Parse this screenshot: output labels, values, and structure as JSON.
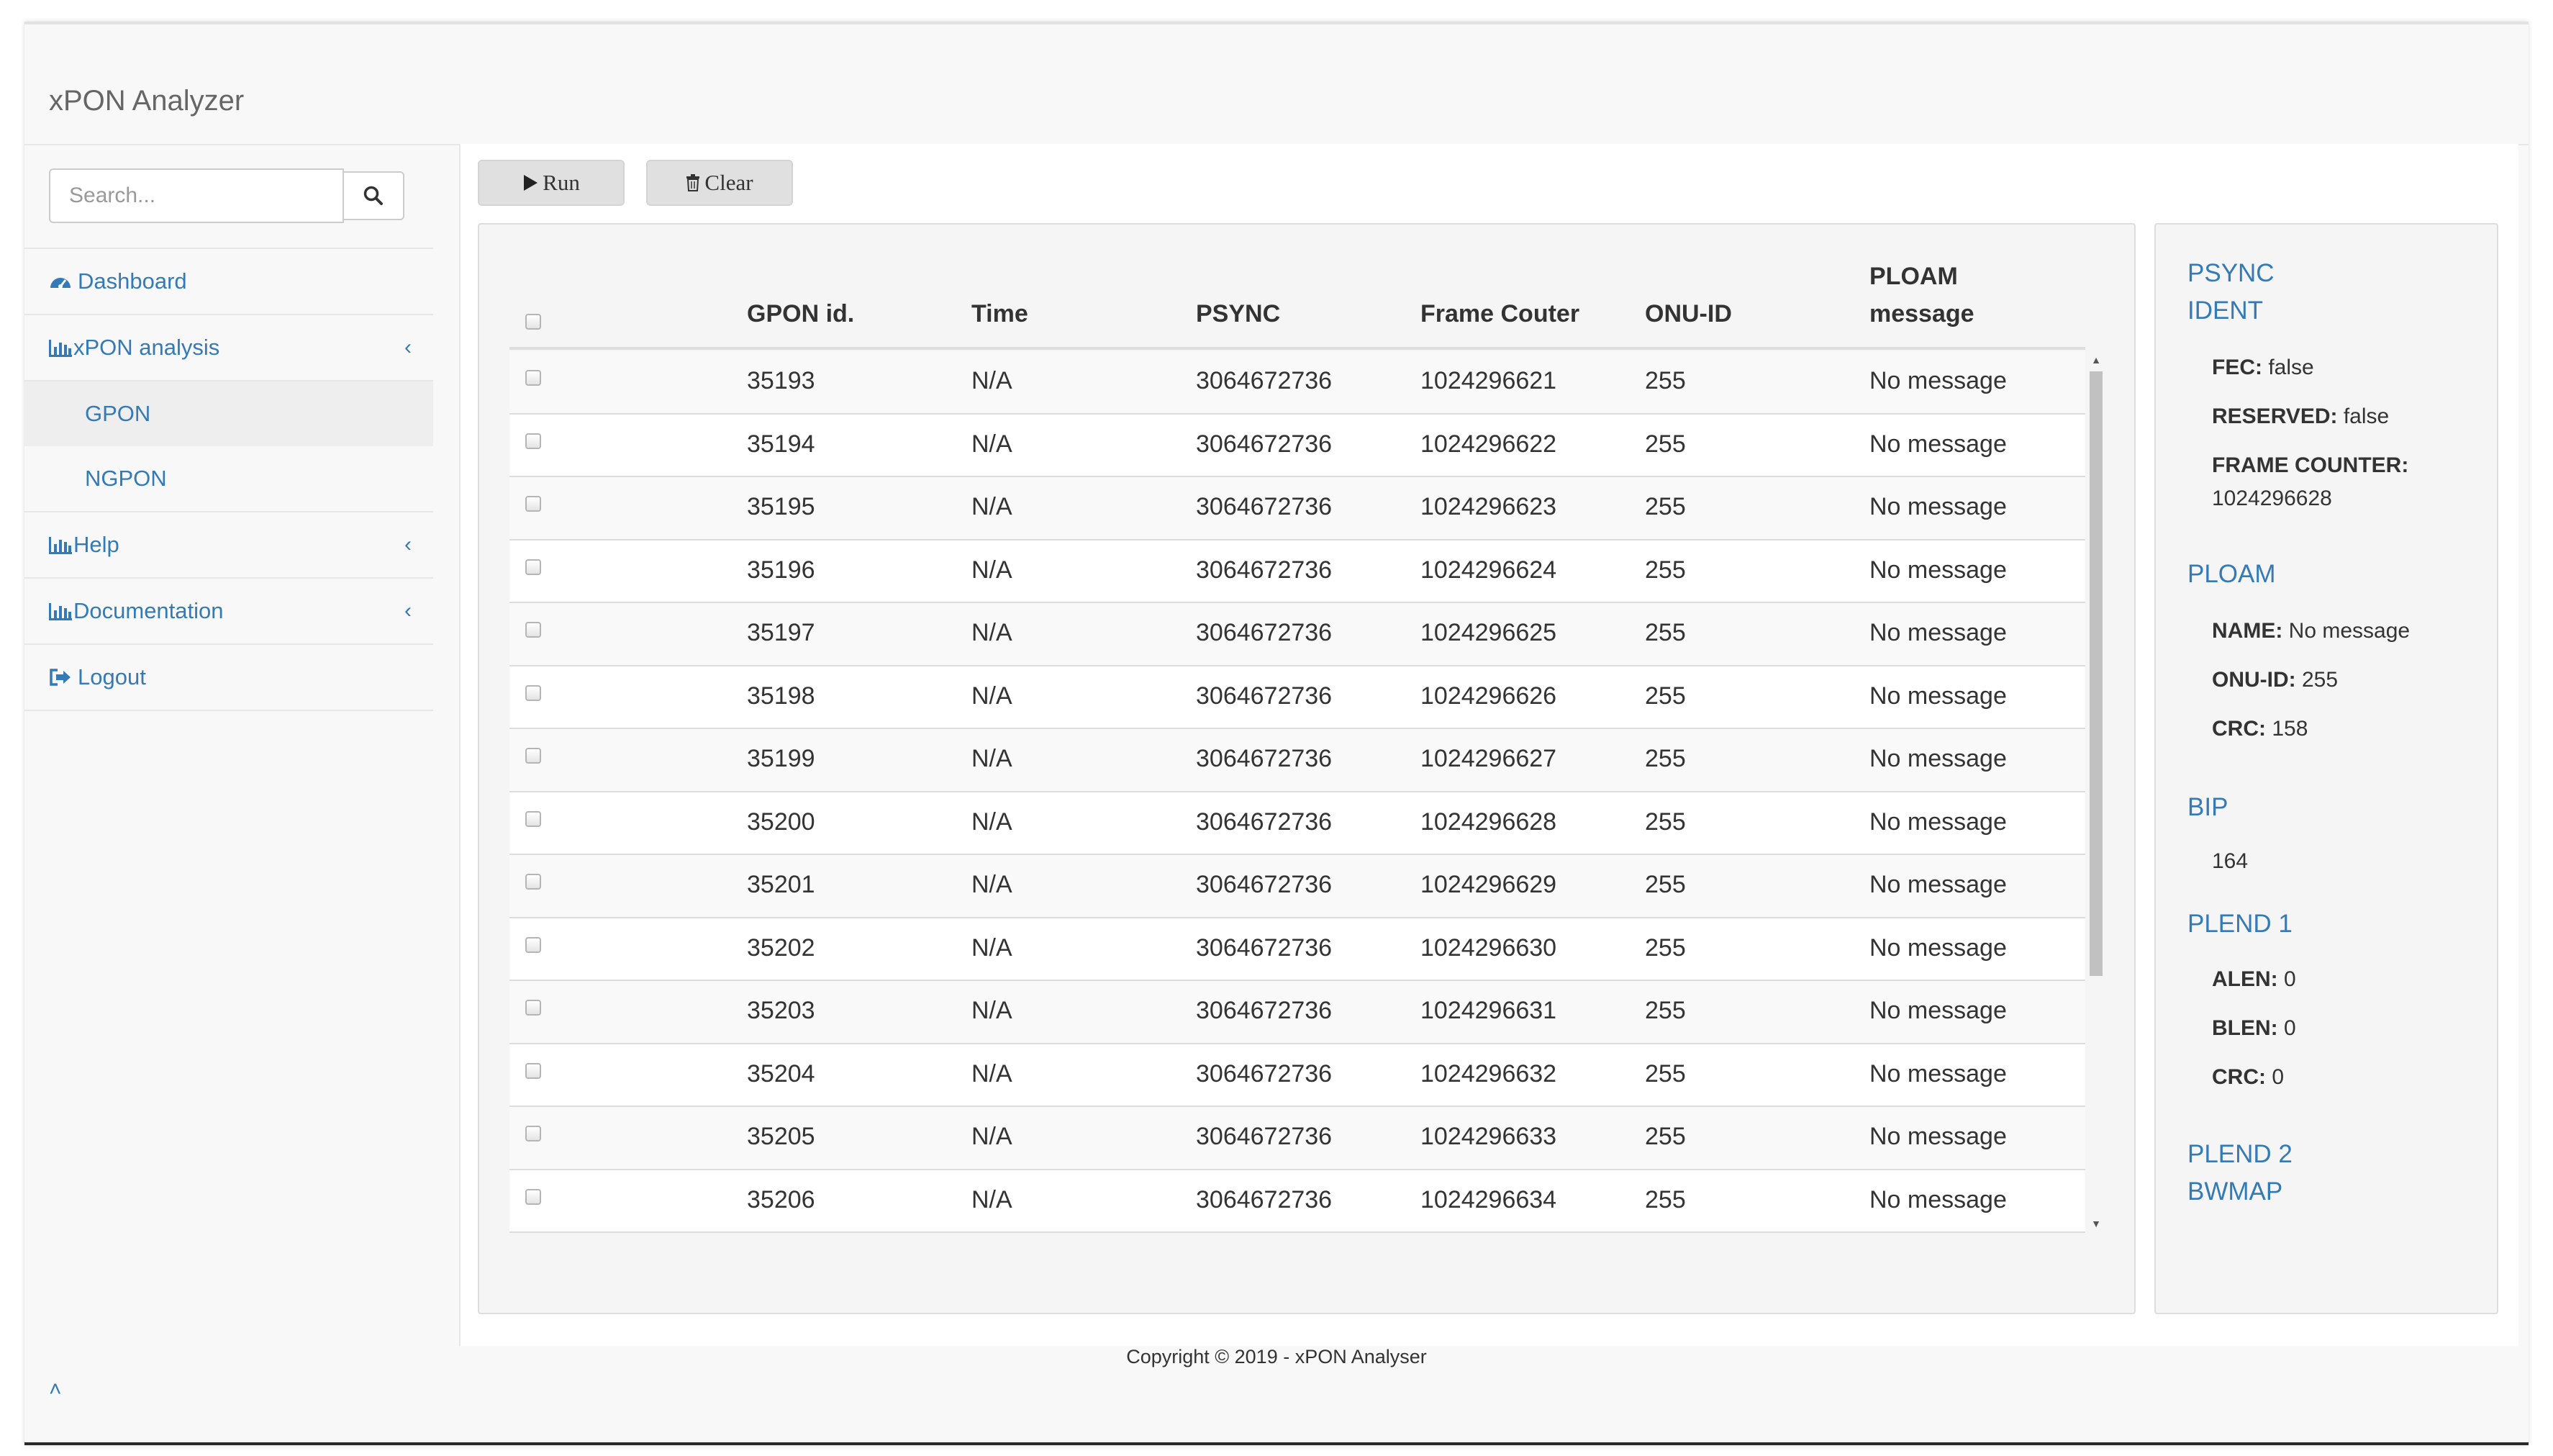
{
  "app": {
    "title": "xPON Analyzer"
  },
  "search": {
    "placeholder": "Search..."
  },
  "sidebar": {
    "dashboard": "Dashboard",
    "xpon_analysis": "xPON analysis",
    "submenu": [
      "GPON",
      "NGPON"
    ],
    "help": "Help",
    "documentation": "Documentation",
    "logout": "Logout"
  },
  "toolbar": {
    "run_label": "Run",
    "clear_label": "Clear"
  },
  "table": {
    "headers": {
      "gpon_id": "GPON id.",
      "time": "Time",
      "psync": "PSYNC",
      "frame_counter": "Frame Couter",
      "onu_id": "ONU-ID",
      "ploam_1": "PLOAM",
      "ploam_2": "message"
    },
    "rows": [
      {
        "id": "35193",
        "time": "N/A",
        "psync": "3064672736",
        "frame": "1024296621",
        "onu": "255",
        "msg": "No message"
      },
      {
        "id": "35194",
        "time": "N/A",
        "psync": "3064672736",
        "frame": "1024296622",
        "onu": "255",
        "msg": "No message"
      },
      {
        "id": "35195",
        "time": "N/A",
        "psync": "3064672736",
        "frame": "1024296623",
        "onu": "255",
        "msg": "No message"
      },
      {
        "id": "35196",
        "time": "N/A",
        "psync": "3064672736",
        "frame": "1024296624",
        "onu": "255",
        "msg": "No message"
      },
      {
        "id": "35197",
        "time": "N/A",
        "psync": "3064672736",
        "frame": "1024296625",
        "onu": "255",
        "msg": "No message"
      },
      {
        "id": "35198",
        "time": "N/A",
        "psync": "3064672736",
        "frame": "1024296626",
        "onu": "255",
        "msg": "No message"
      },
      {
        "id": "35199",
        "time": "N/A",
        "psync": "3064672736",
        "frame": "1024296627",
        "onu": "255",
        "msg": "No message"
      },
      {
        "id": "35200",
        "time": "N/A",
        "psync": "3064672736",
        "frame": "1024296628",
        "onu": "255",
        "msg": "No message"
      },
      {
        "id": "35201",
        "time": "N/A",
        "psync": "3064672736",
        "frame": "1024296629",
        "onu": "255",
        "msg": "No message"
      },
      {
        "id": "35202",
        "time": "N/A",
        "psync": "3064672736",
        "frame": "1024296630",
        "onu": "255",
        "msg": "No message"
      },
      {
        "id": "35203",
        "time": "N/A",
        "psync": "3064672736",
        "frame": "1024296631",
        "onu": "255",
        "msg": "No message"
      },
      {
        "id": "35204",
        "time": "N/A",
        "psync": "3064672736",
        "frame": "1024296632",
        "onu": "255",
        "msg": "No message"
      },
      {
        "id": "35205",
        "time": "N/A",
        "psync": "3064672736",
        "frame": "1024296633",
        "onu": "255",
        "msg": "No message"
      },
      {
        "id": "35206",
        "time": "N/A",
        "psync": "3064672736",
        "frame": "1024296634",
        "onu": "255",
        "msg": "No message"
      }
    ]
  },
  "details": {
    "psync_title_1": "PSYNC",
    "ident_title": "IDENT",
    "fec_label": "FEC:",
    "fec_value": "false",
    "reserved_label": "RESERVED:",
    "reserved_value": "false",
    "frame_counter_label": "FRAME COUNTER:",
    "frame_counter_value": "1024296628",
    "ploam_title": "PLOAM",
    "name_label": "NAME:",
    "name_value": "No message",
    "onu_label": "ONU-ID:",
    "onu_value": "255",
    "crc_label": "CRC:",
    "crc_value": "158",
    "bip_title": "BIP",
    "bip_value": "164",
    "plend1_title": "PLEND 1",
    "alen_label": "ALEN:",
    "alen_value": "0",
    "blen_label": "BLEN:",
    "blen_value": "0",
    "plend_crc_label": "CRC:",
    "plend_crc_value": "0",
    "plend2_title": "PLEND 2",
    "bwmap_title": "BWMAP"
  },
  "footer": {
    "copyright": "Copyright © 2019 - xPON Analyser"
  },
  "colors": {
    "link": "#337ab7",
    "panel_bg": "#f5f5f5",
    "border": "#dddddd"
  }
}
